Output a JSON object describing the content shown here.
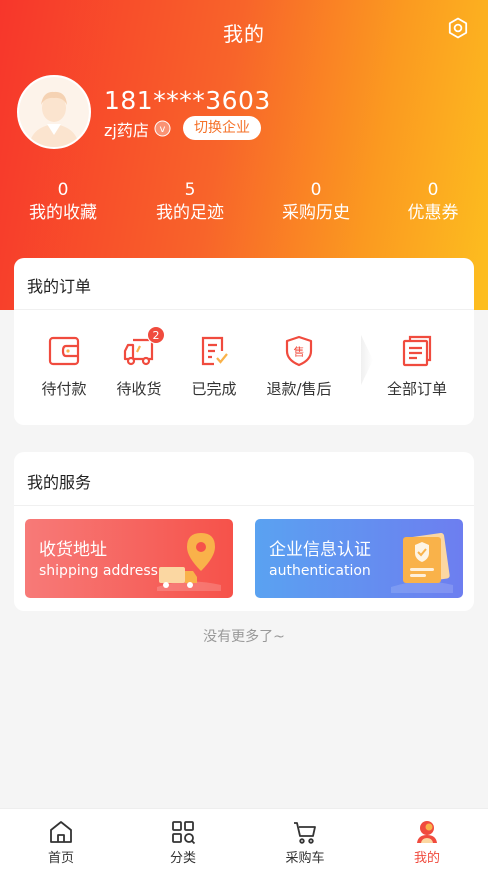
{
  "header": {
    "title": "我的"
  },
  "user": {
    "phone": "181****3603",
    "shop": "zj药店",
    "verify_mark": "v",
    "switch_label": "切换企业"
  },
  "stats": [
    {
      "num": "0",
      "label": "我的收藏"
    },
    {
      "num": "5",
      "label": "我的足迹"
    },
    {
      "num": "0",
      "label": "采购历史"
    },
    {
      "num": "0",
      "label": "优惠券"
    }
  ],
  "orders": {
    "title": "我的订单",
    "items": [
      {
        "label": "待付款",
        "icon": "wallet-icon"
      },
      {
        "label": "待收货",
        "icon": "truck-icon",
        "badge": "2"
      },
      {
        "label": "已完成",
        "icon": "completed-icon"
      },
      {
        "label": "退款/售后",
        "icon": "shield-icon",
        "glyph": "售"
      },
      {
        "label": "全部订单",
        "icon": "orders-list-icon"
      }
    ]
  },
  "services": {
    "title": "我的服务",
    "items": [
      {
        "title": "收货地址",
        "subtitle": "shipping address",
        "color_from": "#f76a6a",
        "color_to": "#f74b40"
      },
      {
        "title": "企业信息认证",
        "subtitle": "authentication",
        "color_from": "#5a9ef0",
        "color_to": "#6e7df0"
      }
    ]
  },
  "footer_text": "没有更多了~",
  "tabbar": {
    "items": [
      {
        "label": "首页",
        "icon": "home-icon"
      },
      {
        "label": "分类",
        "icon": "category-icon"
      },
      {
        "label": "采购车",
        "icon": "cart-icon"
      },
      {
        "label": "我的",
        "icon": "profile-icon",
        "active": true
      }
    ]
  },
  "colors": {
    "accent": "#f04b3e",
    "gradient_start": "#f7362b",
    "gradient_end": "#fdbf1f"
  }
}
